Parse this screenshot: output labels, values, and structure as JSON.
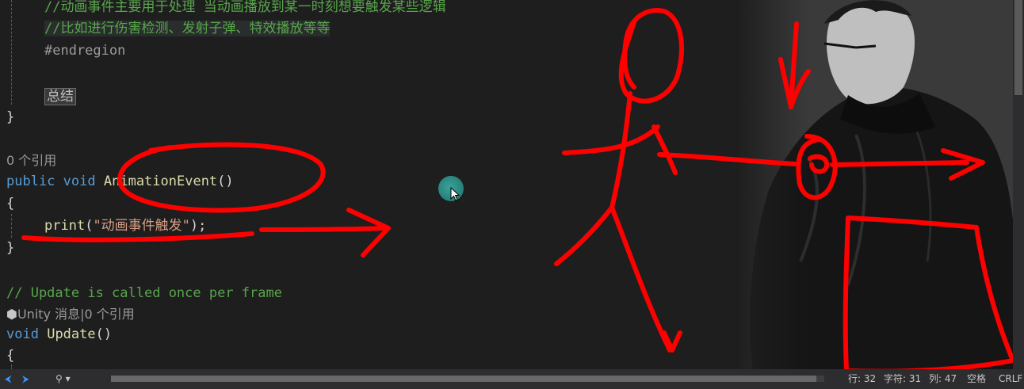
{
  "code": {
    "line1": "//动画事件主要用于处理 当动画播放到某一时刻想要触发某些逻辑",
    "line2": "//比如进行伤害检测、发射子弹、特效播放等等",
    "line3": "#endregion",
    "line4_summary": "总结",
    "line5_brace": "}",
    "lens1": "0 个引用",
    "sig_public": "public",
    "sig_void": "void",
    "sig_name": "AnimationEvent",
    "sig_parens": "()",
    "open_brace": "{",
    "print_fn": "print",
    "print_open": "(",
    "print_str": "\"动画事件触发\"",
    "print_close": ");",
    "close_brace": "}",
    "update_comment": "// Update is called once per frame",
    "lens2": "Unity 消息|0 个引用",
    "upd_void": "void",
    "upd_name": "Update",
    "upd_parens": "()",
    "upd_brace": "{"
  },
  "statusbar": {
    "row": "行: 32",
    "chars": "字符: 31",
    "col": "列: 47",
    "space": "空格",
    "eol": "CRLF"
  },
  "colors": {
    "annotation": "#ff0000",
    "comment": "#57a64a",
    "keyword": "#569cd6"
  },
  "icons": [
    "unity-cube-icon",
    "nav-back-icon",
    "nav-forward-icon",
    "branch-icon"
  ]
}
